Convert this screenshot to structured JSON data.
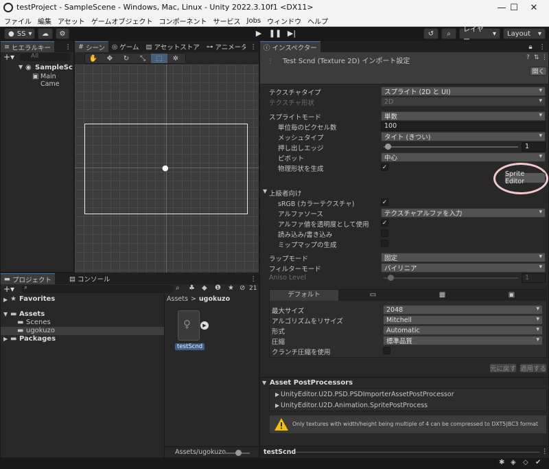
{
  "window": {
    "title": "testProject - SampleScene - Windows, Mac, Linux - Unity 2022.3.10f1 <DX11>",
    "minimize": "—",
    "maximize": "☐",
    "close": "✕"
  },
  "menu": [
    "ファイル",
    "編集",
    "アセット",
    "ゲームオブジェクト",
    "コンポーネント",
    "サービス",
    "Jobs",
    "ウィンドウ",
    "ヘルプ"
  ],
  "toolbar": {
    "account": "SS",
    "layers": "レイヤー",
    "layout": "Layout"
  },
  "hierarchy": {
    "tab": "ヒエラルキー",
    "search_placeholder": "All",
    "scene": "SampleSc",
    "item": "Main Came"
  },
  "scene_view": {
    "tabs": [
      "シーン",
      "ゲーム",
      "アセットストア",
      "アニメーター"
    ]
  },
  "project": {
    "tabs": [
      "プロジェクト",
      "コンソール"
    ],
    "hidden_count": "21",
    "tree": {
      "favorites": "Favorites",
      "assets": "Assets",
      "scenes": "Scenes",
      "ugokuzo": "ugokuzo",
      "packages": "Packages"
    },
    "breadcrumb": {
      "root": "Assets",
      "sep": ">",
      "current": "ugokuzo"
    },
    "asset_label": "testScnd",
    "footer_path": "Assets/ugokuzo"
  },
  "inspector": {
    "tab": "インスペクター",
    "title": "Test Scnd (Texture 2D) インポート設定",
    "open": "開く",
    "texture_type": {
      "label": "テクスチャタイプ",
      "value": "スプライト (2D と UI)"
    },
    "texture_shape": {
      "label": "テクスチャ形状",
      "value": "2D"
    },
    "sprite_mode": {
      "label": "スプライトモード",
      "value": "単数"
    },
    "ppu": {
      "label": "単位毎のピクセル数",
      "value": "100"
    },
    "mesh_type": {
      "label": "メッシュタイプ",
      "value": "タイト (きつい)"
    },
    "extrude": {
      "label": "押し出しエッジ",
      "value": "1"
    },
    "pivot": {
      "label": "ピボット",
      "value": "中心"
    },
    "physics_shape": {
      "label": "物理形状を生成"
    },
    "sprite_editor": "Sprite Editor",
    "advanced": "上級者向け",
    "srgb": {
      "label": "sRGB (カラーテクスチャ)"
    },
    "alpha_source": {
      "label": "アルファソース",
      "value": "テクスチャアルファを入力"
    },
    "alpha_transparency": {
      "label": "アルファ値を透明度として使用"
    },
    "read_write": {
      "label": "読み込み/書き込み"
    },
    "mipmaps": {
      "label": "ミップマップの生成"
    },
    "wrap_mode": {
      "label": "ラップモード",
      "value": "固定"
    },
    "filter_mode": {
      "label": "フィルターモード",
      "value": "バイリニア"
    },
    "aniso": {
      "label": "Aniso Level",
      "value": "1"
    },
    "platform": {
      "default_tab": "デフォルト",
      "max_size": {
        "label": "最大サイズ",
        "value": "2048"
      },
      "resize": {
        "label": "アルゴリズムをリサイズ",
        "value": "Mitchell"
      },
      "format": {
        "label": "形式",
        "value": "Automatic"
      },
      "compression": {
        "label": "圧縮",
        "value": "標準品質"
      },
      "crunch": {
        "label": "クランチ圧縮を使用"
      }
    },
    "revert": "元に戻す",
    "apply": "適用する",
    "postprocessors": {
      "title": "Asset PostProcessors",
      "items": [
        "UnityEditor.U2D.PSD.PSDImporterAssetPostProcessor",
        "UnityEditor.U2D.Animation.SpritePostProcess"
      ]
    },
    "warning": "Only textures with width/height being multiple of 4 can be compressed to DXT5|BC3 format",
    "footer": "testScnd"
  },
  "colors": {
    "accent": "#3a79bb",
    "highlight_circle": "#f2c9cc",
    "warning": "#f5c000"
  }
}
